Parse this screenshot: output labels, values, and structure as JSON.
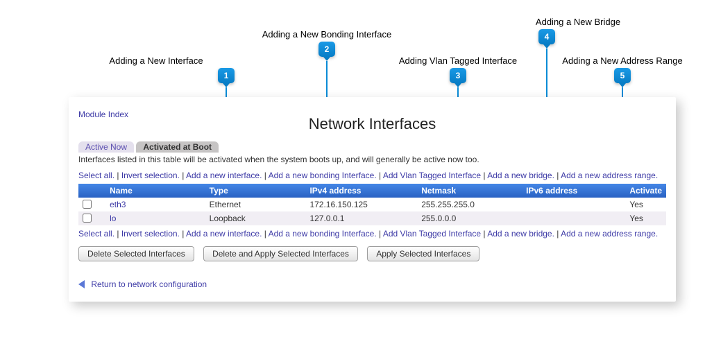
{
  "callouts": [
    {
      "n": "1",
      "label": "Adding a New Interface"
    },
    {
      "n": "2",
      "label": "Adding a New Bonding Interface"
    },
    {
      "n": "3",
      "label": "Adding Vlan Tagged Interface"
    },
    {
      "n": "4",
      "label": "Adding a New Bridge"
    },
    {
      "n": "5",
      "label": "Adding a New Address Range"
    }
  ],
  "module_index": "Module Index",
  "page_title": "Network Interfaces",
  "tabs": {
    "inactive": "Active Now",
    "active": "Activated at Boot"
  },
  "description": "Interfaces listed in this table will be activated when the system boots up, and will generally be active now too.",
  "actions": {
    "select_all": "Select all.",
    "invert": "Invert selection.",
    "add_iface": "Add a new interface.",
    "add_bond": "Add a new bonding Interface.",
    "add_vlan": "Add Vlan Tagged Interface",
    "add_bridge": "Add a new bridge.",
    "add_range": "Add a new address range."
  },
  "table": {
    "headers": {
      "name": "Name",
      "type": "Type",
      "ipv4": "IPv4 address",
      "netmask": "Netmask",
      "ipv6": "IPv6 address",
      "activate": "Activate"
    },
    "rows": [
      {
        "name": "eth3",
        "type": "Ethernet",
        "ipv4": "172.16.150.125",
        "netmask": "255.255.255.0",
        "ipv6": "",
        "activate": "Yes"
      },
      {
        "name": "lo",
        "type": "Loopback",
        "ipv4": "127.0.0.1",
        "netmask": "255.0.0.0",
        "ipv6": "",
        "activate": "Yes"
      }
    ]
  },
  "buttons": {
    "delete": "Delete Selected Interfaces",
    "delete_apply": "Delete and Apply Selected Interfaces",
    "apply": "Apply Selected Interfaces"
  },
  "return_link": "Return to network configuration"
}
